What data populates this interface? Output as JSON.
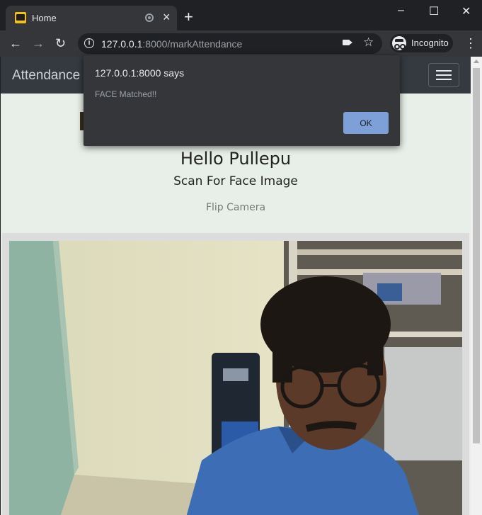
{
  "browser": {
    "tab_title": "Home",
    "new_tab_icon": "+",
    "url_host": "127.0.0.1",
    "url_path": ":8000/markAttendance",
    "incognito_label": "Incognito",
    "window_controls": [
      "–",
      "☐",
      "✕"
    ]
  },
  "page": {
    "brand": "Attendance",
    "greeting": "Hello Pullepu",
    "subtitle": "Scan For Face Image",
    "flip_label": "Flip Camera",
    "background_color": "#e8efe8",
    "navbar_color": "#343a40"
  },
  "dialog": {
    "title": "127.0.0.1:8000 says",
    "message": "FACE Matched!!",
    "ok_label": "OK",
    "ok_color": "#7ea0d9"
  }
}
